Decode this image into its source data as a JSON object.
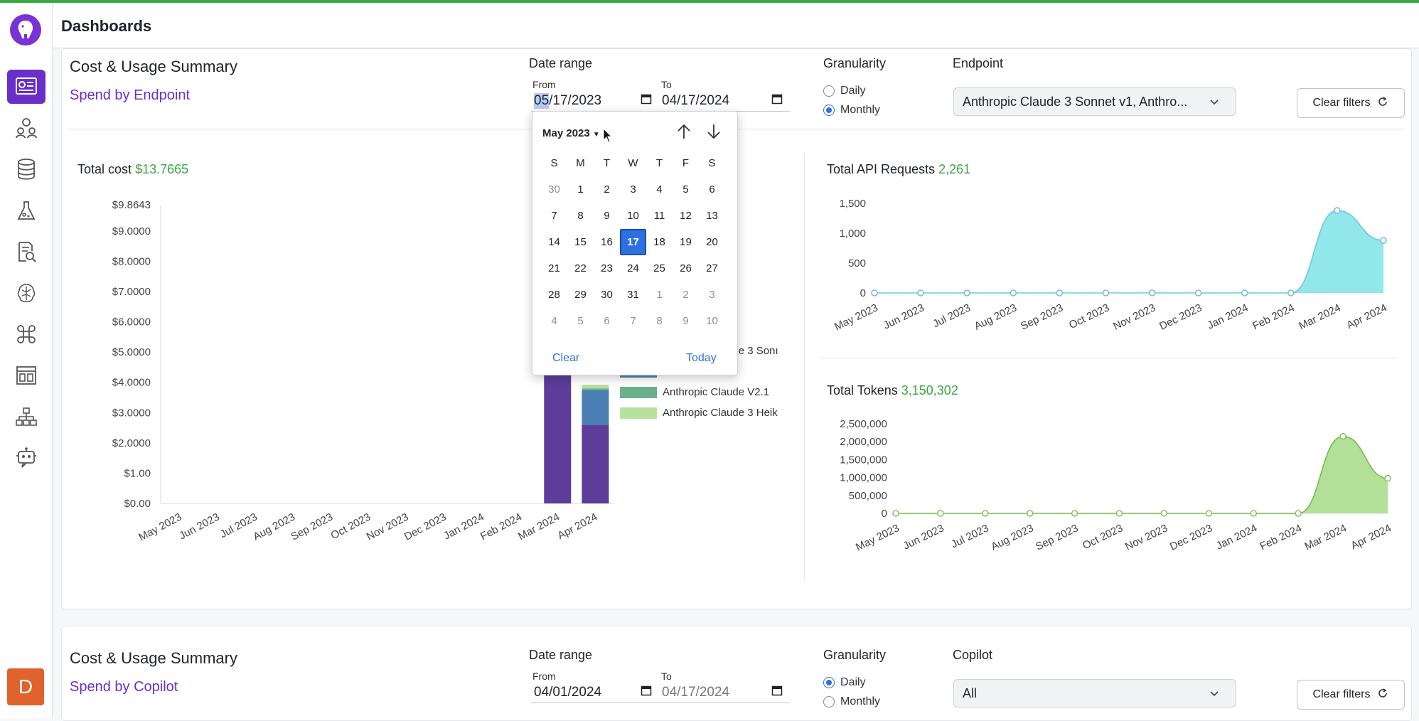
{
  "app": {
    "page_title": "Dashboards",
    "avatar_initial": "D"
  },
  "sidebar": {
    "items": [
      {
        "name": "dashboard-icon",
        "active": true
      },
      {
        "name": "users-icon"
      },
      {
        "name": "database-icon"
      },
      {
        "name": "flask-icon"
      },
      {
        "name": "document-search-icon"
      },
      {
        "name": "brain-icon"
      },
      {
        "name": "command-icon"
      },
      {
        "name": "layout-icon"
      },
      {
        "name": "hierarchy-icon"
      },
      {
        "name": "bot-icon"
      }
    ]
  },
  "summary1": {
    "title": "Cost & Usage Summary",
    "subtitle": "Spend by Endpoint",
    "date_range_label": "Date range",
    "from_label": "From",
    "from_value_selected": "05",
    "from_value_rest": "/17/2023",
    "to_label": "To",
    "to_value": "04/17/2024",
    "granularity_label": "Granularity",
    "granularity_options": [
      "Daily",
      "Monthly"
    ],
    "granularity_selected": "Monthly",
    "endpoint_label": "Endpoint",
    "endpoint_value": "Anthropic Claude 3 Sonnet v1, Anthro...",
    "clear_filters": "Clear filters"
  },
  "datepicker": {
    "month_label": "May 2023",
    "weekdays": [
      "S",
      "M",
      "T",
      "W",
      "T",
      "F",
      "S"
    ],
    "weeks": [
      [
        "30",
        "1",
        "2",
        "3",
        "4",
        "5",
        "6"
      ],
      [
        "7",
        "8",
        "9",
        "10",
        "11",
        "12",
        "13"
      ],
      [
        "14",
        "15",
        "16",
        "17",
        "18",
        "19",
        "20"
      ],
      [
        "21",
        "22",
        "23",
        "24",
        "25",
        "26",
        "27"
      ],
      [
        "28",
        "29",
        "30",
        "31",
        "1",
        "2",
        "3"
      ],
      [
        "4",
        "5",
        "6",
        "7",
        "8",
        "9",
        "10"
      ]
    ],
    "selected_day": "17",
    "clear_label": "Clear",
    "today_label": "Today"
  },
  "total_cost": {
    "label": "Total cost",
    "value": "$13.7665"
  },
  "total_requests": {
    "label": "Total API Requests",
    "value": "2,261"
  },
  "total_tokens": {
    "label": "Total Tokens",
    "value": "3,150,302"
  },
  "chart_data": [
    {
      "type": "bar",
      "stacked": true,
      "categories": [
        "May 2023",
        "Jun 2023",
        "Jul 2023",
        "Aug 2023",
        "Sep 2023",
        "Oct 2023",
        "Nov 2023",
        "Dec 2023",
        "Jan 2024",
        "Feb 2024",
        "Mar 2024",
        "Apr 2024"
      ],
      "y_ticks": [
        "$0.00",
        "$1.00",
        "$2.0000",
        "$3.0000",
        "$4.0000",
        "$5.0000",
        "$6.0000",
        "$7.0000",
        "$8.0000",
        "$9.0000",
        "$9.8643"
      ],
      "y_tick_values": [
        0,
        1,
        2,
        3,
        4,
        5,
        6,
        7,
        8,
        9,
        9.8643
      ],
      "ylim": [
        0,
        9.8643
      ],
      "series": [
        {
          "name": "Anthropic Claude 3 Sonnet",
          "color": "#5c3d99",
          "values": [
            0,
            0,
            0,
            0,
            0,
            0,
            0,
            0,
            0,
            0,
            9.8643,
            2.6
          ]
        },
        {
          "name": "GPT4",
          "color": "#4a7fb5",
          "values": [
            0,
            0,
            0,
            0,
            0,
            0,
            0,
            0,
            0,
            0,
            0,
            1.15
          ]
        },
        {
          "name": "Anthropic Claude V2.1",
          "color": "#6ab08a",
          "values": [
            0,
            0,
            0,
            0,
            0,
            0,
            0,
            0,
            0,
            0,
            0,
            0.05
          ]
        },
        {
          "name": "Anthropic Claude 3 Heik",
          "color": "#b8e0a0",
          "values": [
            0,
            0,
            0,
            0,
            0,
            0,
            0,
            0,
            0,
            0,
            0,
            0.12
          ]
        }
      ],
      "legend_visible": [
        "Anthropic Claude 3 Sonı",
        "GPT4",
        "Anthropic Claude V2.1",
        "Anthropic Claude 3 Heik"
      ]
    },
    {
      "type": "area",
      "x": [
        "May 2023",
        "Jun 2023",
        "Jul 2023",
        "Aug 2023",
        "Sep 2023",
        "Oct 2023",
        "Nov 2023",
        "Dec 2023",
        "Jan 2024",
        "Feb 2024",
        "Mar 2024",
        "Apr 2024"
      ],
      "values": [
        0,
        0,
        0,
        0,
        0,
        0,
        0,
        0,
        0,
        0,
        1380,
        880
      ],
      "y_ticks": [
        "0",
        "500",
        "1,000",
        "1,500"
      ],
      "y_tick_values": [
        0,
        500,
        1000,
        1500
      ],
      "ylim": [
        0,
        1500
      ],
      "color": "#7fe3e8"
    },
    {
      "type": "area",
      "x": [
        "May 2023",
        "Jun 2023",
        "Jul 2023",
        "Aug 2023",
        "Sep 2023",
        "Oct 2023",
        "Nov 2023",
        "Dec 2023",
        "Jan 2024",
        "Feb 2024",
        "Mar 2024",
        "Apr 2024"
      ],
      "values": [
        0,
        0,
        0,
        0,
        0,
        0,
        0,
        0,
        0,
        0,
        2150000,
        980000
      ],
      "y_ticks": [
        "0",
        "500,000",
        "1,000,000",
        "1,500,000",
        "2,000,000",
        "2,500,000"
      ],
      "y_tick_values": [
        0,
        500000,
        1000000,
        1500000,
        2000000,
        2500000
      ],
      "ylim": [
        0,
        2500000
      ],
      "color": "#a6da86"
    }
  ],
  "summary2": {
    "title": "Cost & Usage Summary",
    "subtitle": "Spend by Copilot",
    "date_range_label": "Date range",
    "from_label": "From",
    "from_value": "04/01/2024",
    "to_label": "To",
    "to_value": "04/17/2024",
    "granularity_label": "Granularity",
    "granularity_options": [
      "Daily",
      "Monthly"
    ],
    "granularity_selected": "Daily",
    "copilot_label": "Copilot",
    "copilot_value": "All",
    "clear_filters": "Clear filters"
  }
}
